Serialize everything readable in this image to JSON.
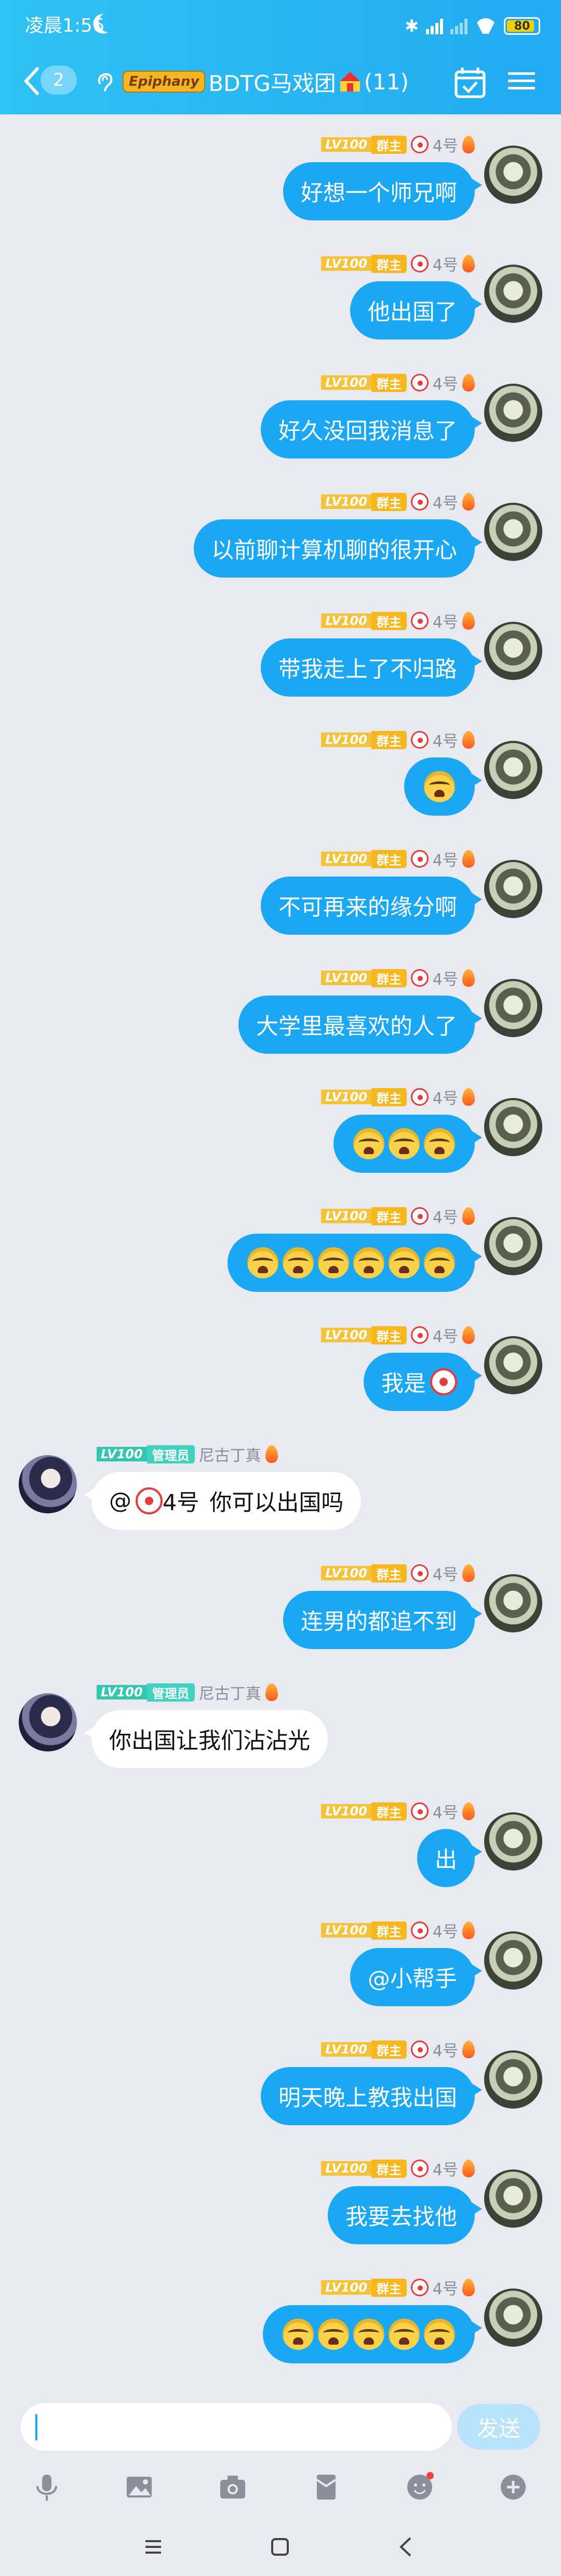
{
  "status_bar": {
    "time": "凌晨1:56",
    "battery": "80"
  },
  "header": {
    "unread_count": "2",
    "group_badge": "Epiphany",
    "group_name": "BDTG马戏团",
    "member_count": "(11)"
  },
  "roles": {
    "owner": "群主",
    "admin": "管理员",
    "level": "LV100"
  },
  "senders": {
    "self": "4号",
    "other": "尼古丁真"
  },
  "messages": [
    {
      "side": "self",
      "text": "好想一个师兄啊"
    },
    {
      "side": "self",
      "text": "他出国了"
    },
    {
      "side": "self",
      "text": "好久没回我消息了"
    },
    {
      "side": "self",
      "text": "以前聊计算机聊的很开心"
    },
    {
      "side": "self",
      "text": "带我走上了不归路"
    },
    {
      "side": "self",
      "text": "",
      "cry": 1
    },
    {
      "side": "self",
      "text": "不可再来的缘分啊"
    },
    {
      "side": "self",
      "text": "大学里最喜欢的人了"
    },
    {
      "side": "self",
      "text": "",
      "cry": 3
    },
    {
      "side": "self",
      "text": "",
      "cry": 6
    },
    {
      "side": "self",
      "text": "我是",
      "clown": true
    },
    {
      "side": "other",
      "mention": "@",
      "mention_name": "4号",
      "text": "你可以出国吗"
    },
    {
      "side": "self",
      "text": "连男的都追不到"
    },
    {
      "side": "other",
      "text": "你出国让我们沾沾光"
    },
    {
      "side": "self",
      "text": "出"
    },
    {
      "side": "self",
      "text": "@小帮手"
    },
    {
      "side": "self",
      "text": "明天晚上教我出国"
    },
    {
      "side": "self",
      "text": "我要去找他"
    },
    {
      "side": "self",
      "text": "",
      "cry": 5
    }
  ],
  "composer": {
    "placeholder": "",
    "send_label": "发送"
  },
  "toolbar": [
    "mic-icon",
    "image-icon",
    "camera-icon",
    "red-packet-icon",
    "emoji-icon",
    "plus-icon"
  ],
  "colors": {
    "header": "#22aaf2",
    "self_bubble": "#1aa7f3",
    "owner_badge": "#f7b71d",
    "admin_badge": "#3fd2c0"
  }
}
